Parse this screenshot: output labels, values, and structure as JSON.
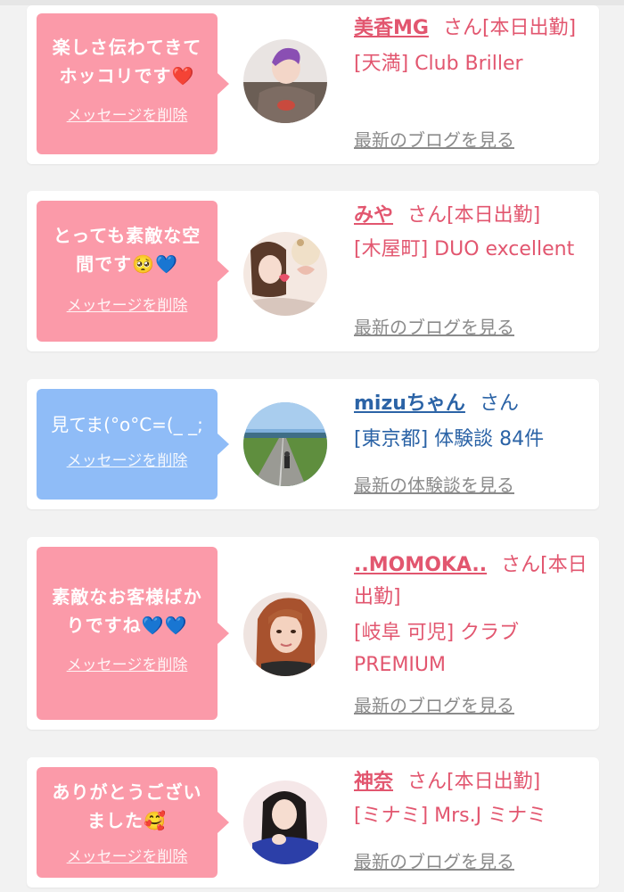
{
  "cards": [
    {
      "message": "楽しさ伝わてきてホッコリです❤️",
      "delete_label": "メッセージを削除",
      "name": "美香MG",
      "suffix": "さん[本日出勤]",
      "shop": "[天満] Club Briller",
      "link": "最新のブログを見る",
      "avatar_icon": "girl-photo-icon"
    },
    {
      "message": "とっても素敵な空間です🥺💙",
      "delete_label": "メッセージを削除",
      "name": "みや",
      "suffix": "さん[本日出勤]",
      "shop": "[木屋町] DUO excellent",
      "link": "最新のブログを見る",
      "avatar_icon": "girl-photo-icon"
    },
    {
      "message": "見てま(°o°C=(_ _;",
      "delete_label": "メッセージを削除",
      "name": "mizuちゃん",
      "suffix": "さん",
      "shop": "[東京都] 体験談 84件",
      "link": "最新の体験談を見る",
      "avatar_icon": "road-photo-icon"
    },
    {
      "message": "素敵なお客様ばかりですね💙💙",
      "delete_label": "メッセージを削除",
      "name": "..MOMOKA..",
      "suffix": "さん[本日出勤]",
      "shop": "[岐阜 可児] クラブ PREMIUM",
      "link": "最新のブログを見る",
      "avatar_icon": "girl-photo-icon"
    },
    {
      "message": "ありがとうございました🥰",
      "delete_label": "メッセージを削除",
      "name": "神奈",
      "suffix": "さん[本日出勤]",
      "shop": "[ミナミ] Mrs.J ミナミ",
      "link": "最新のブログを見る",
      "avatar_icon": "girl-photo-icon"
    }
  ],
  "colors": {
    "pink_bubble": "#fb9aa9",
    "blue_bubble": "#8fbcf7",
    "pink_text": "#e2566f",
    "blue_text": "#2b63a6",
    "link_gray": "#8b8b8b"
  }
}
